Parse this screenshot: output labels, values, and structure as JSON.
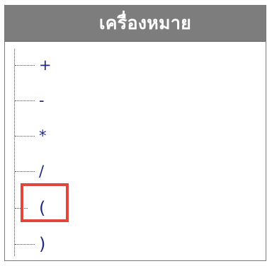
{
  "panel": {
    "title": "เครื่องหมาย"
  },
  "tree": {
    "items": [
      {
        "label": "+"
      },
      {
        "label": "-"
      },
      {
        "label": "*"
      },
      {
        "label": "/"
      },
      {
        "label": "("
      },
      {
        "label": ")"
      }
    ],
    "selected_label": "("
  },
  "colors": {
    "header_bg": "#7d7d7d",
    "header_text": "#ffffff",
    "item_text": "#1f2a80",
    "highlight": "#e0463c"
  }
}
